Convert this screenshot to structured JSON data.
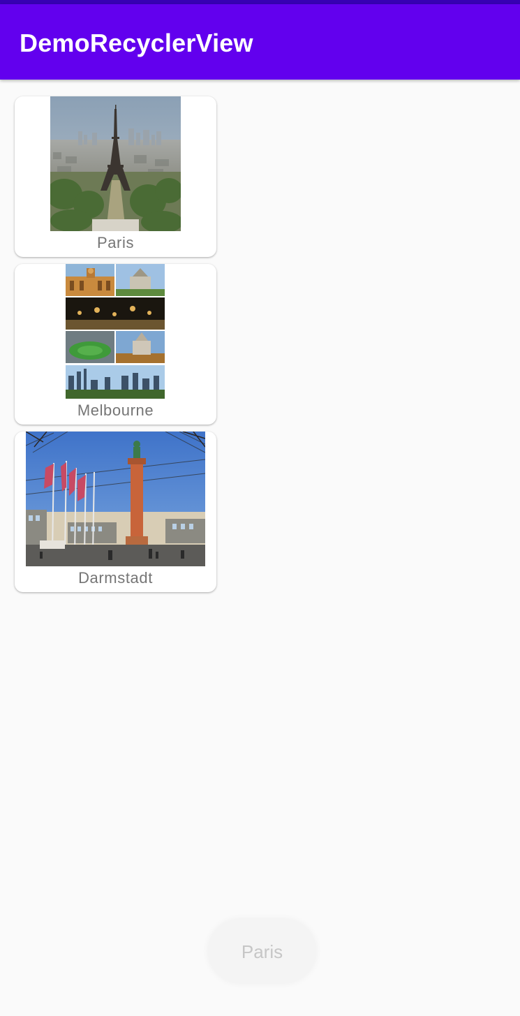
{
  "app_bar": {
    "title": "DemoRecyclerView"
  },
  "cards": [
    {
      "label": "Paris",
      "image_icon": "eiffel-tower-photo"
    },
    {
      "label": "Melbourne",
      "image_icon": "melbourne-collage-photo"
    },
    {
      "label": "Darmstadt",
      "image_icon": "darmstadt-square-photo"
    }
  ],
  "toast": {
    "text": "Paris"
  },
  "colors": {
    "primary": "#6200ee",
    "primary_dark": "#3700b3",
    "background": "#fafafa",
    "label_text": "#757575"
  }
}
